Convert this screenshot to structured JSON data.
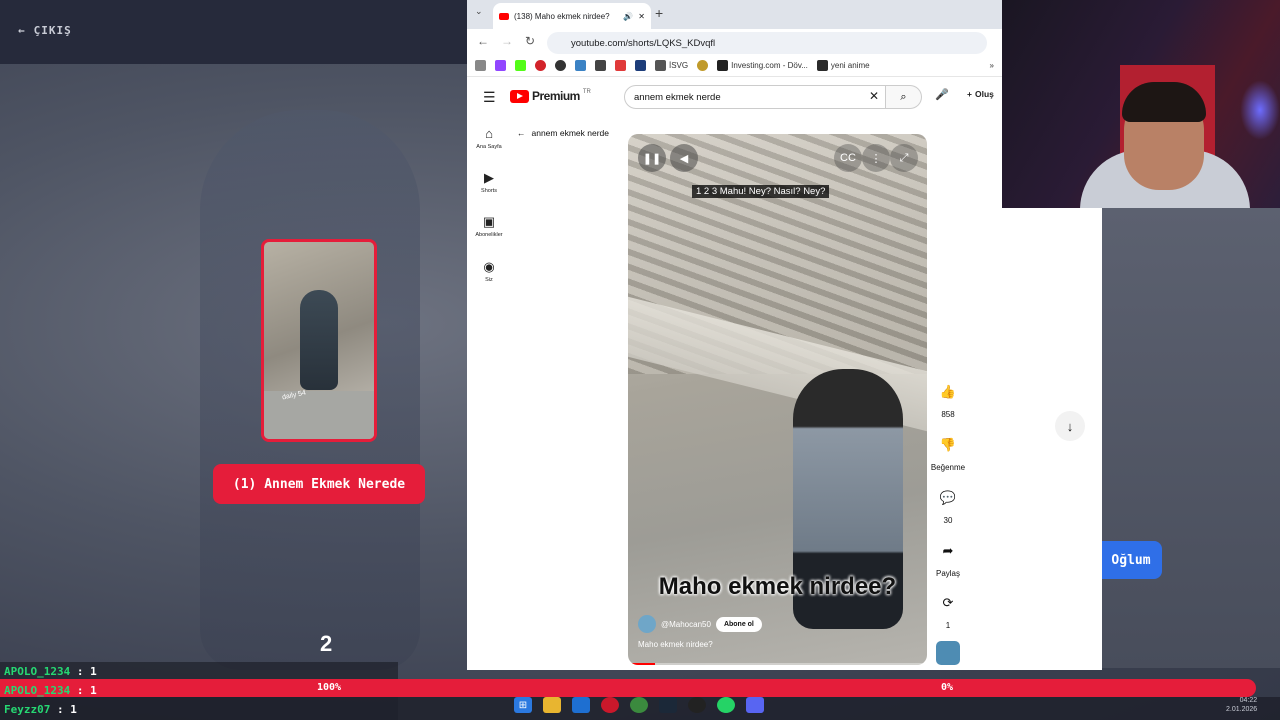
{
  "game": {
    "exit_label": "ÇIKIŞ",
    "answer_button": "(1) Annem Ekmek Nerede",
    "other_button": "Oğlum",
    "round": "2",
    "card_watermark": "daily 54",
    "scores": [
      {
        "name": "APOLO_1234",
        "value": ": 1"
      },
      {
        "name": "APOLO_1234",
        "value": ": 1"
      },
      {
        "name": "Feyzz07",
        "value": ": 1"
      }
    ],
    "bar_left_label": "100%",
    "bar_right_label": "0%",
    "colors": {
      "accent_red": "#e51d3a",
      "accent_blue": "#2f6fe8",
      "score_green": "#26d873"
    }
  },
  "browser": {
    "tab_title": "(138) Maho ekmek nirdee?",
    "url": "youtube.com/shorts/LQKS_KDvqfl",
    "bookmarks": [
      "İSVG",
      "Investing.com - Döv...",
      "yeni anime"
    ],
    "bookmark_overflow": "»"
  },
  "youtube": {
    "logo_text": "Premium",
    "logo_region": "TR",
    "search_value": "annem ekmek nerde",
    "create_label": "Oluş",
    "nav": [
      {
        "label": "Ana Sayfa",
        "icon": "home-icon"
      },
      {
        "label": "Shorts",
        "icon": "shorts-icon"
      },
      {
        "label": "Abonelikler",
        "icon": "subscriptions-icon"
      },
      {
        "label": "Siz",
        "icon": "you-icon"
      }
    ],
    "back_label": "annem ekmek nerde",
    "video": {
      "caption": "1 2 3 Mahu! Ney? Nasıl? Ney?",
      "title_overlay": "Maho ekmek nirdee?",
      "channel": "@Mahocan50",
      "subscribe": "Abone ol",
      "description": "Maho ekmek nirdee?",
      "progress": 0.09
    },
    "actions": {
      "likes": "858",
      "dislike": "Beğenme",
      "comments": "30",
      "share": "Paylaş",
      "remix": "1"
    }
  },
  "taskbar": {
    "time": "04:22",
    "date": "2.01.2026"
  }
}
